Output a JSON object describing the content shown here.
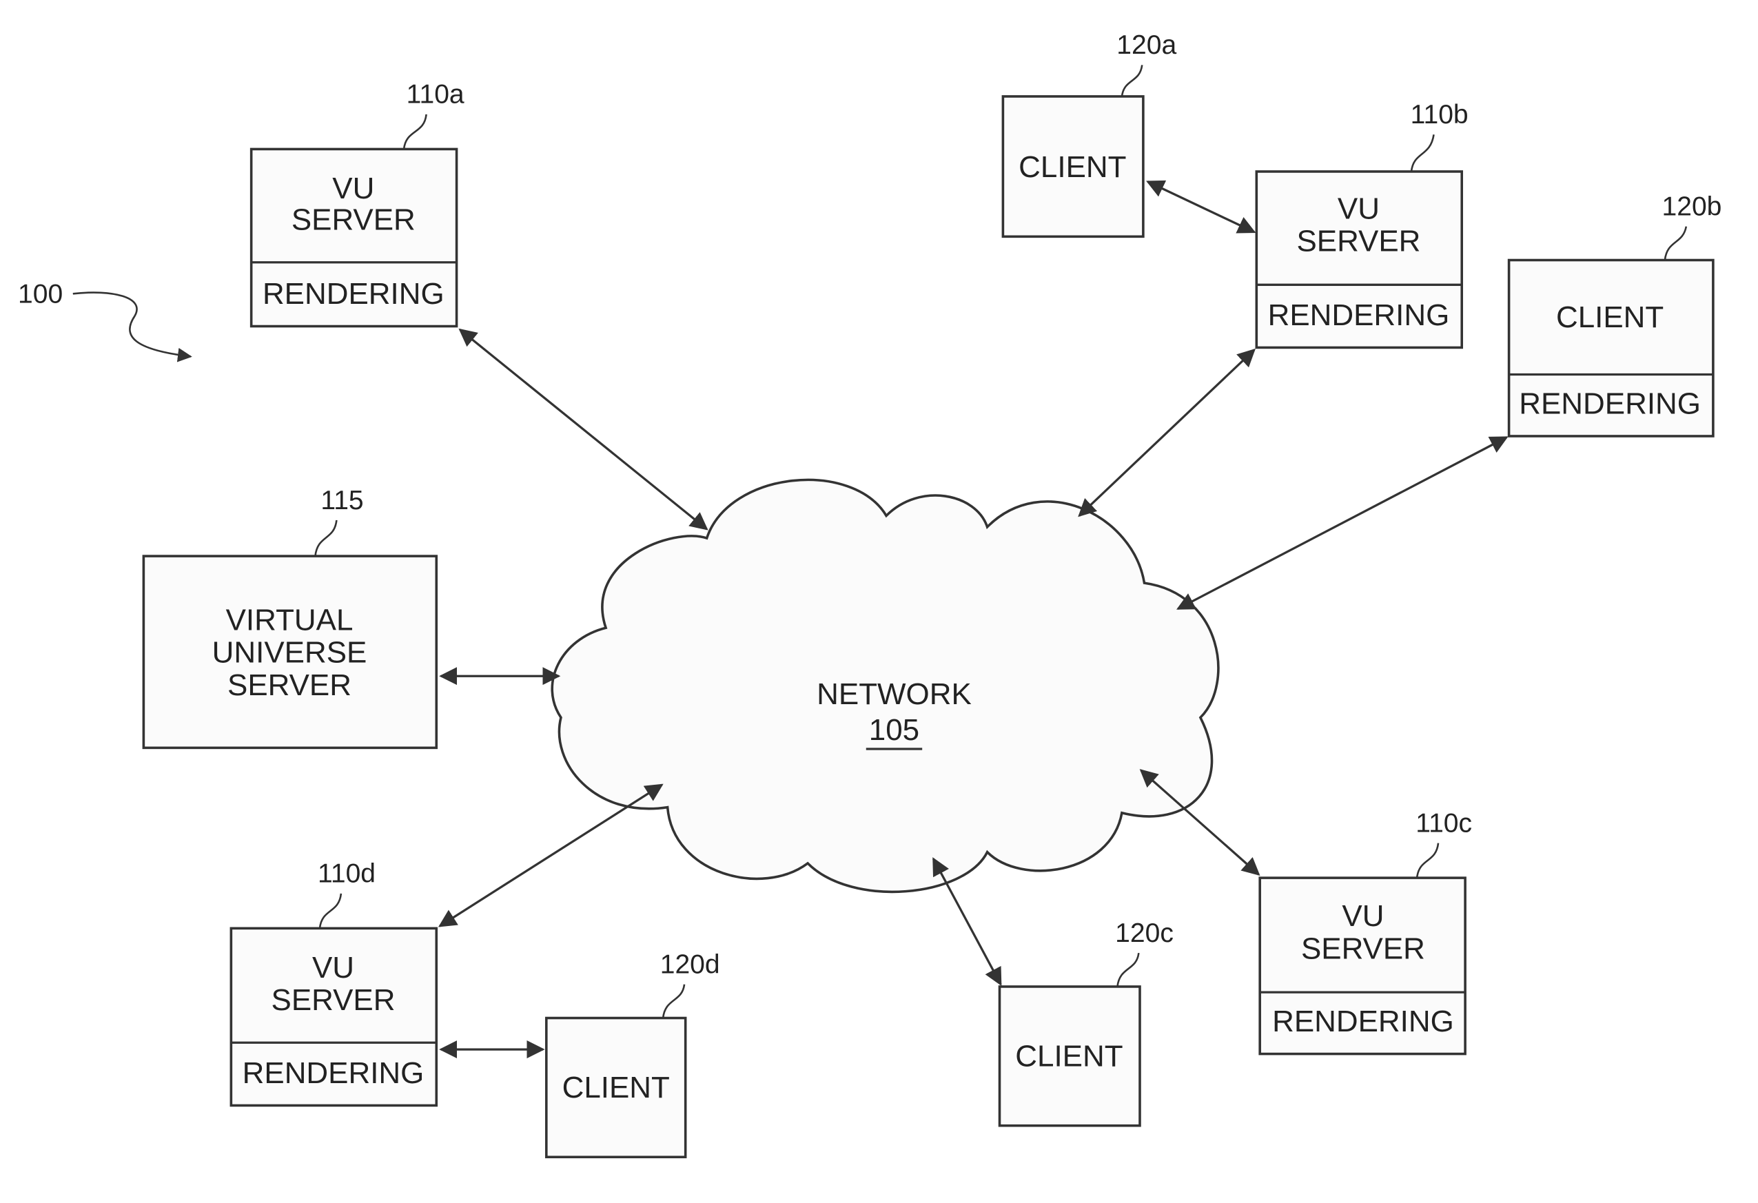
{
  "figure_ref": "100",
  "network": {
    "label": "NETWORK",
    "ref": "105"
  },
  "vu_central": {
    "ref": "115",
    "lines": [
      "VIRTUAL",
      "UNIVERSE",
      "SERVER"
    ]
  },
  "vu_servers": [
    {
      "ref": "110a",
      "line1": "VU",
      "line2": "SERVER",
      "sub": "RENDERING"
    },
    {
      "ref": "110b",
      "line1": "VU",
      "line2": "SERVER",
      "sub": "RENDERING"
    },
    {
      "ref": "110c",
      "line1": "VU",
      "line2": "SERVER",
      "sub": "RENDERING"
    },
    {
      "ref": "110d",
      "line1": "VU",
      "line2": "SERVER",
      "sub": "RENDERING"
    }
  ],
  "clients": [
    {
      "ref": "120a",
      "label": "CLIENT"
    },
    {
      "ref": "120b",
      "label": "CLIENT",
      "sub": "RENDERING"
    },
    {
      "ref": "120c",
      "label": "CLIENT"
    },
    {
      "ref": "120d",
      "label": "CLIENT"
    }
  ]
}
